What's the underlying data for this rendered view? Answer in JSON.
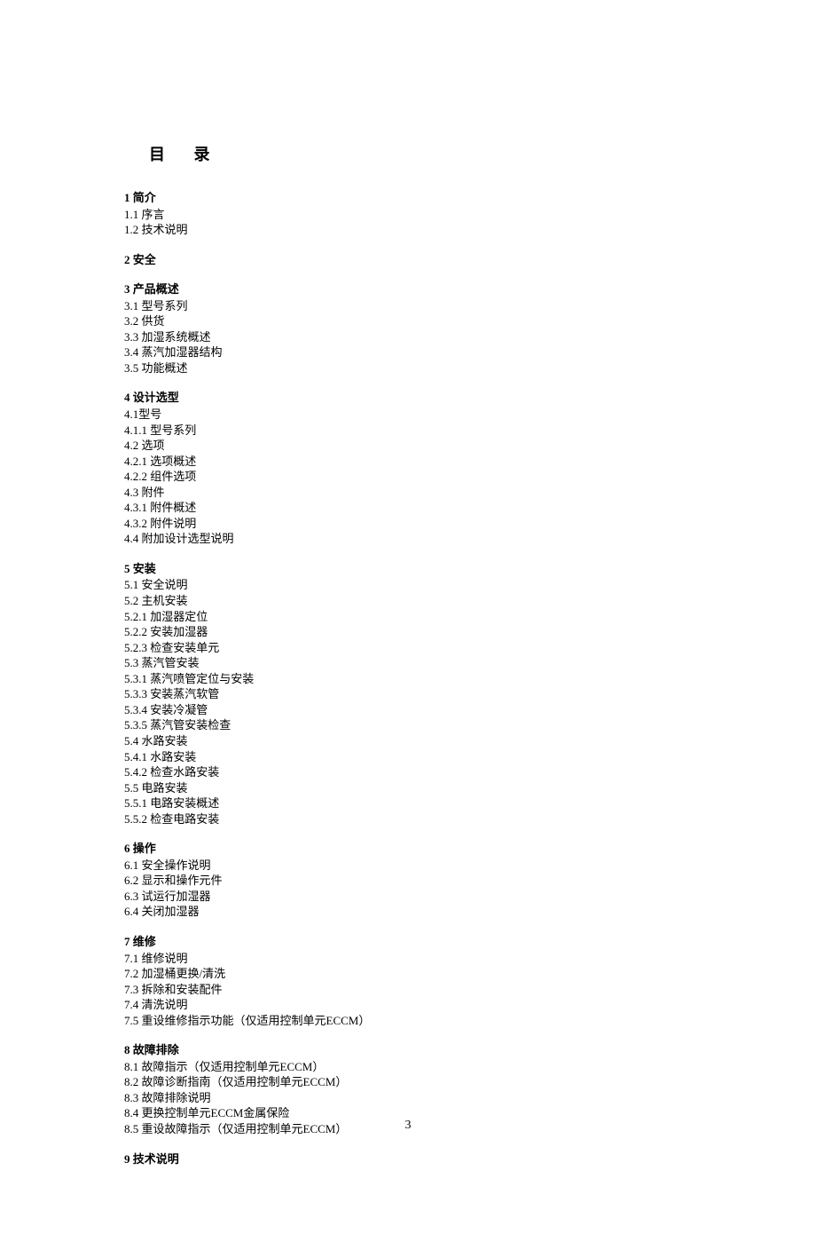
{
  "title": "目 录",
  "page_number": "3",
  "sections": [
    {
      "heading": "1 简介",
      "entries": [
        "1.1 序言",
        "1.2 技术说明"
      ]
    },
    {
      "heading": "2 安全",
      "entries": []
    },
    {
      "heading": "3 产品概述",
      "entries": [
        "3.1 型号系列",
        "3.2 供货",
        "3.3 加湿系统概述",
        "3.4 蒸汽加湿器结构",
        "3.5 功能概述"
      ]
    },
    {
      "heading": "4 设计选型",
      "entries": [
        "4.1型号",
        "4.1.1 型号系列",
        "4.2 选项",
        "4.2.1 选项概述",
        "4.2.2 组件选项",
        "4.3 附件",
        "4.3.1 附件概述",
        "4.3.2 附件说明",
        "4.4 附加设计选型说明"
      ]
    },
    {
      "heading": "5 安装",
      "entries": [
        "5.1 安全说明",
        "5.2 主机安装",
        "5.2.1 加湿器定位",
        "5.2.2 安装加湿器",
        "5.2.3 检查安装单元",
        "5.3 蒸汽管安装",
        "5.3.1 蒸汽喷管定位与安装",
        "5.3.3 安装蒸汽软管",
        "5.3.4 安装冷凝管",
        "5.3.5 蒸汽管安装检查",
        "5.4 水路安装",
        "5.4.1 水路安装",
        "5.4.2 检查水路安装",
        "5.5 电路安装",
        "5.5.1 电路安装概述",
        "5.5.2 检查电路安装"
      ]
    },
    {
      "heading": "6 操作",
      "entries": [
        "6.1 安全操作说明",
        "6.2 显示和操作元件",
        "6.3 试运行加湿器",
        "6.4 关闭加湿器"
      ]
    },
    {
      "heading": "7 维修",
      "entries": [
        "7.1 维修说明",
        "7.2 加湿桶更换/清洗",
        "7.3 拆除和安装配件",
        "7.4 清洗说明",
        "7.5 重设维修指示功能（仅适用控制单元ECCM）"
      ]
    },
    {
      "heading": "8 故障排除",
      "entries": [
        "8.1 故障指示（仅适用控制单元ECCM）",
        "8.2 故障诊断指南（仅适用控制单元ECCM）",
        "8.3 故障排除说明",
        "8.4 更换控制单元ECCM金属保险",
        "8.5 重设故障指示（仅适用控制单元ECCM）"
      ]
    },
    {
      "heading": "9 技术说明",
      "entries": []
    }
  ]
}
